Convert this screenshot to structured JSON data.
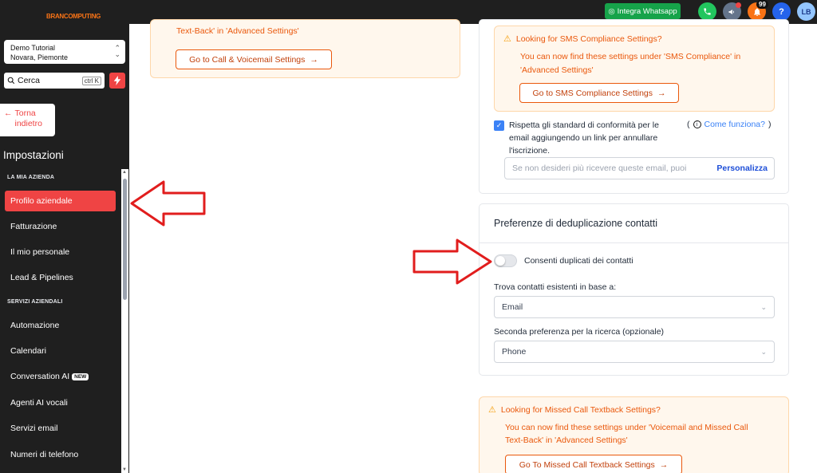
{
  "topbar": {
    "logo": "BRANCOMPUTING",
    "whatsapp_label": "Integra Whatsapp",
    "notification_count": "99",
    "help_label": "?",
    "avatar_initials": "LB"
  },
  "sidebar": {
    "location_name": "Demo Tutorial",
    "location_sub": "Novara, Piemonte",
    "search_placeholder": "Cerca",
    "search_shortcut": "ctrl K",
    "back_label_1": "Torna",
    "back_label_2": "indietro",
    "section_title": "Impostazioni",
    "groups": [
      {
        "label": "LA MIA AZIENDA"
      },
      {
        "label": "SERVIZI AZIENDALI"
      }
    ],
    "items": [
      {
        "label": "Profilo aziendale",
        "active": true
      },
      {
        "label": "Fatturazione"
      },
      {
        "label": "Il mio personale"
      },
      {
        "label": "Lead & Pipelines"
      },
      {
        "label": "Automazione"
      },
      {
        "label": "Calendari"
      },
      {
        "label": "Conversation AI",
        "badge": "NEW"
      },
      {
        "label": "Agenti AI vocali"
      },
      {
        "label": "Servizi email"
      },
      {
        "label": "Numeri di telefono"
      }
    ]
  },
  "left_notice": {
    "text": "Text-Back' in 'Advanced Settings'",
    "button": "Go to Call & Voicemail Settings"
  },
  "sms_notice": {
    "title": "Looking for SMS Compliance Settings?",
    "body_1": "You can now find these settings under 'SMS Compliance' in",
    "body_2": "'Advanced Settings'",
    "button": "Go to SMS Compliance Settings"
  },
  "email_compliance": {
    "checked": true,
    "text_1": "Rispetta gli standard di conformità per le",
    "text_2": "email aggiungendo un link per annullare",
    "text_3": "l'iscrizione.",
    "help_open": "(",
    "help_link": "Come funziona?",
    "help_close": ")",
    "placeholder": "Se non desideri più ricevere queste email, puoi",
    "customize": "Personalizza"
  },
  "dedup": {
    "title": "Preferenze di deduplicazione contatti",
    "toggle_label": "Consenti duplicati dei contatti",
    "toggle_on": false,
    "primary_label": "Trova contatti esistenti in base a:",
    "primary_value": "Email",
    "secondary_label": "Seconda preferenza per la ricerca (opzionale)",
    "secondary_value": "Phone"
  },
  "missed_call_notice": {
    "title": "Looking for Missed Call Textback Settings?",
    "body_1": "You can now find these settings under 'Voicemail and Missed Call",
    "body_2": "Text-Back' in 'Advanced Settings'",
    "button": "Go To Missed Call Textback Settings"
  },
  "colors": {
    "accent": "#ef4444",
    "notice_text": "#ea580c",
    "annotation_arrow": "#e11d1d"
  }
}
